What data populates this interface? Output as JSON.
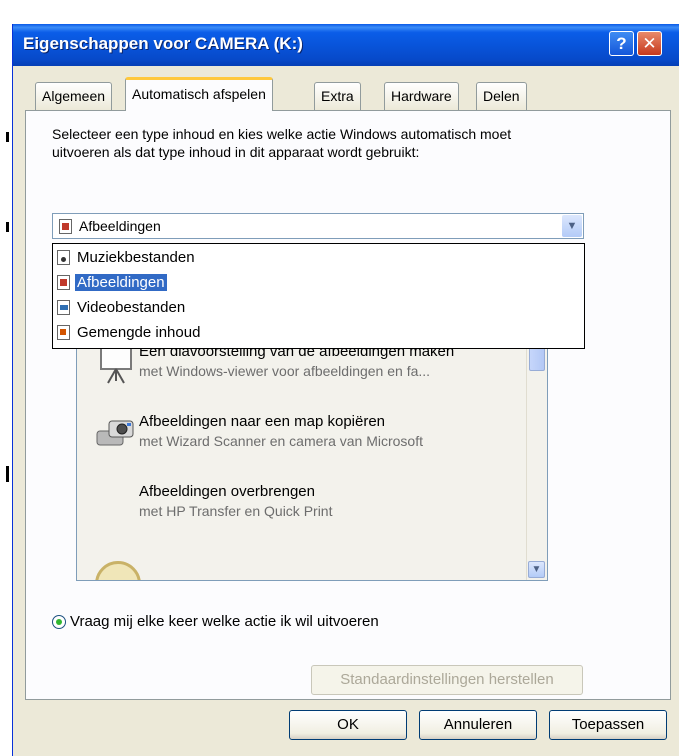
{
  "window": {
    "title": "Eigenschappen voor CAMERA (K:)",
    "help_glyph": "?",
    "close_glyph": "✕"
  },
  "tabs": [
    {
      "label": "Algemeen"
    },
    {
      "label": "Automatisch afspelen"
    },
    {
      "label": "Extra"
    },
    {
      "label": "Hardware"
    },
    {
      "label": "Delen"
    }
  ],
  "description": "Selecteer een type inhoud en kies welke actie Windows automatisch moet uitvoeren als dat type inhoud in dit apparaat wordt gebruikt:",
  "content_type": {
    "selected": "Afbeeldingen",
    "options": [
      {
        "label": "Muziekbestanden",
        "icon": "music-file-icon"
      },
      {
        "label": "Afbeeldingen",
        "icon": "picture-file-icon"
      },
      {
        "label": "Videobestanden",
        "icon": "video-file-icon"
      },
      {
        "label": "Gemengde inhoud",
        "icon": "mixed-content-icon"
      }
    ]
  },
  "actions": [
    {
      "title": "Een diavoorstelling van de afbeeldingen maken",
      "subtitle": "met Windows-viewer voor afbeeldingen en fa...",
      "icon": "slideshow-projector-icon"
    },
    {
      "title": "Afbeeldingen naar een map kopiëren",
      "subtitle": "met Wizard Scanner en camera van Microsoft",
      "icon": "camera-scanner-icon"
    },
    {
      "title": "Afbeeldingen overbrengen",
      "subtitle": "met HP Transfer en Quick Print",
      "icon": ""
    }
  ],
  "radio_ask_label": "Vraag mij elke keer welke actie ik wil uitvoeren",
  "buttons": {
    "restore_defaults": "Standaardinstellingen herstellen",
    "ok": "OK",
    "cancel": "Annuleren",
    "apply": "Toepassen"
  },
  "colors": {
    "titlebar": "#0853d8",
    "selection": "#316ac5",
    "tab_highlight": "#ffc83c"
  }
}
